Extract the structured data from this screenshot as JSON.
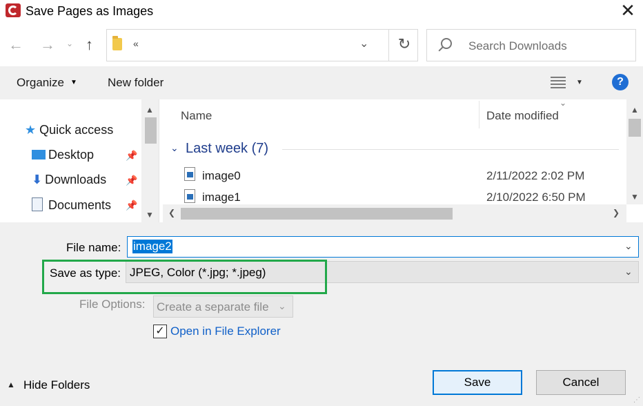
{
  "window": {
    "title": "Save Pages as Images",
    "close_glyph": "✕"
  },
  "nav": {
    "back_glyph": "←",
    "forward_glyph": "→",
    "recent_glyph": "⌄",
    "up_glyph": "↑",
    "address_chevron": "«",
    "address_drop_glyph": "⌄",
    "refresh_glyph": "↻",
    "search_placeholder": "Search Downloads"
  },
  "toolbar": {
    "organize_label": "Organize",
    "caret_glyph": "▼",
    "new_folder_label": "New folder",
    "help_glyph": "?"
  },
  "sidebar": {
    "items": [
      {
        "label": "Quick access",
        "icon": "star-icon",
        "pinned": false
      },
      {
        "label": "Desktop",
        "icon": "desktop-icon",
        "pinned": true
      },
      {
        "label": "Downloads",
        "icon": "download-arrow-icon",
        "pinned": true
      },
      {
        "label": "Documents",
        "icon": "document-icon",
        "pinned": true
      }
    ],
    "pin_glyph": "📌"
  },
  "filelist": {
    "columns": {
      "name": "Name",
      "date": "Date modified"
    },
    "sort_glyph": "⌄",
    "group": {
      "label": "Last week (7)",
      "chevron": "⌄"
    },
    "files": [
      {
        "name": "image0",
        "date": "2/11/2022 2:02 PM"
      },
      {
        "name": "image1",
        "date": "2/10/2022 6:50 PM"
      }
    ]
  },
  "scroll_glyphs": {
    "up": "▲",
    "down": "▼",
    "left": "❮",
    "right": "❯"
  },
  "form": {
    "file_name_label": "File name:",
    "file_name_value": "image2",
    "save_type_label": "Save as type:",
    "save_type_value": "JPEG, Color (*.jpg; *.jpeg)",
    "file_options_label": "File Options:",
    "file_options_value": "Create a separate file",
    "open_explorer_label": "Open in File Explorer",
    "open_explorer_checked": true,
    "check_glyph": "✓",
    "drop_glyph": "⌄"
  },
  "footer": {
    "hide_folders_label": "Hide Folders",
    "hide_caret": "▲",
    "save_label": "Save",
    "cancel_label": "Cancel",
    "grip_glyph": "⋰"
  },
  "colors": {
    "accent": "#0078d7",
    "highlight_border": "#22a84a",
    "group_label": "#1f3d8c",
    "link": "#1060c8"
  }
}
